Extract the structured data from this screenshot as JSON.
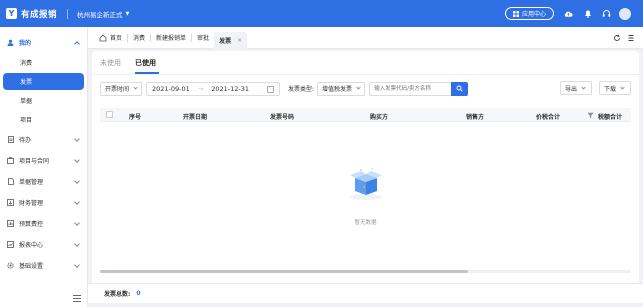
{
  "header": {
    "logo_glyph": "Y",
    "app_title": "有成报销",
    "company": "杭州易企新正式",
    "app_center_label": "应用中心",
    "brand_color": "#2f6fe4"
  },
  "sidebar": {
    "groups": [
      {
        "label": "我的",
        "icon": "user-icon",
        "expanded": true,
        "items": [
          {
            "label": "消费"
          },
          {
            "label": "发票",
            "selected": true
          },
          {
            "label": "单据"
          },
          {
            "label": "项目"
          }
        ]
      },
      {
        "label": "待办",
        "icon": "todo-icon"
      },
      {
        "label": "项目与合同",
        "icon": "contract-icon"
      },
      {
        "label": "单据管理",
        "icon": "document-icon"
      },
      {
        "label": "财务管理",
        "icon": "finance-icon"
      },
      {
        "label": "预算费控",
        "icon": "budget-icon"
      },
      {
        "label": "报表中心",
        "icon": "report-icon"
      },
      {
        "label": "基础设置",
        "icon": "settings-icon"
      }
    ]
  },
  "tabs": {
    "home": "首页",
    "items": [
      "消费",
      "新建报销单",
      "审批"
    ],
    "current": "发票"
  },
  "main": {
    "subtabs": [
      "未使用",
      "已使用"
    ],
    "active_subtab": "已使用",
    "filters": {
      "date_type": "开票时间",
      "start_date": "2021-09-01",
      "arrow": "→",
      "end_date": "2021-12-31",
      "invoice_type_label": "发票类型:",
      "invoice_type_value": "增值税发票",
      "search_placeholder": "输入发票代码/卖方名称",
      "export_label": "导出",
      "download_label": "下载"
    },
    "columns": [
      "序号",
      "开票日期",
      "发票号码",
      "购买方",
      "销售方",
      "价税合计",
      "税额合计"
    ],
    "empty_text": "暂无数据"
  },
  "footer": {
    "total_label": "发票总数:",
    "total_value": "0"
  }
}
